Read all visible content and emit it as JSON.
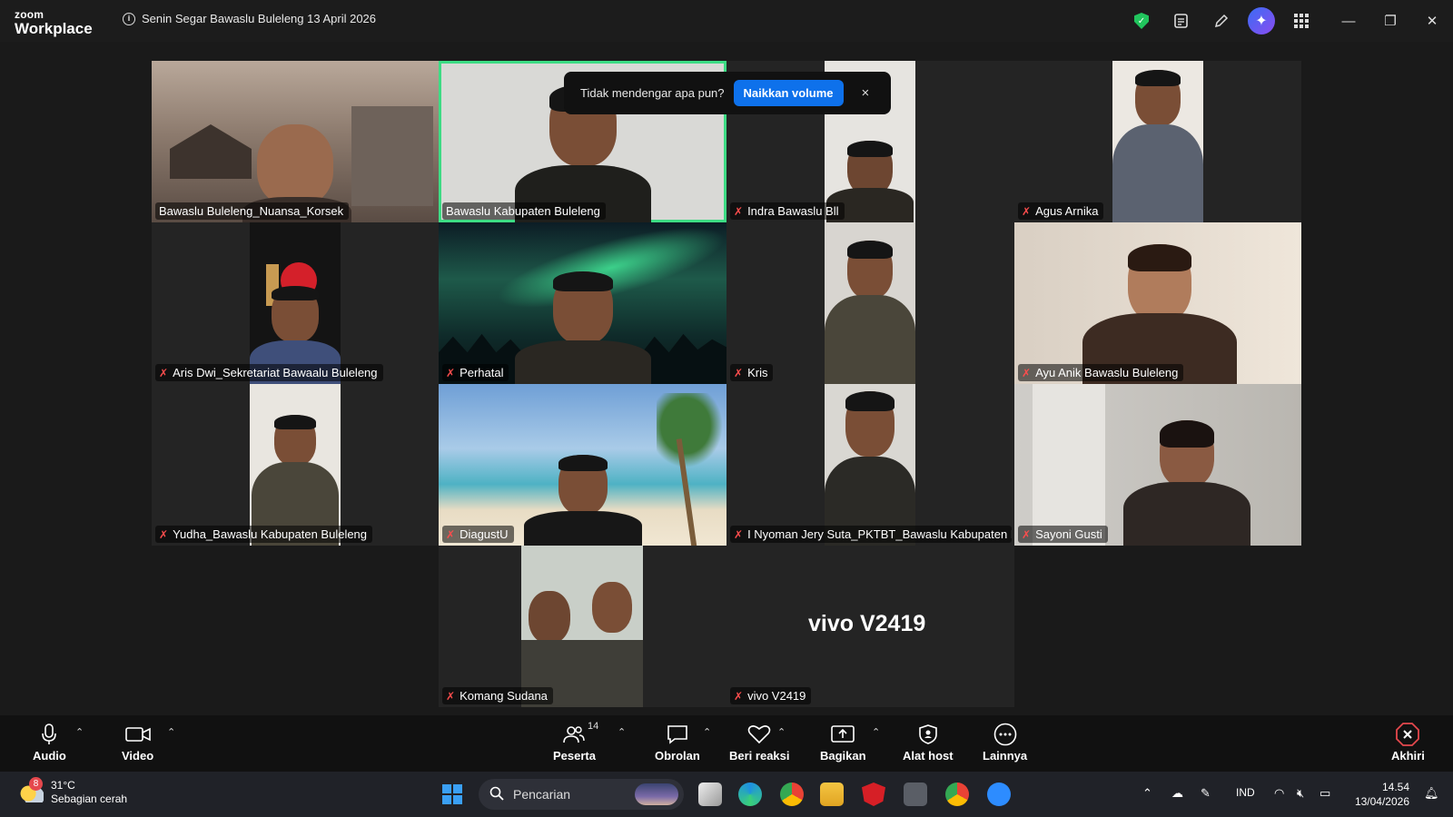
{
  "app": {
    "brand_small": "zoom",
    "brand_large": "Workplace",
    "meeting_title": "Senin Segar Bawaslu Buleleng 13 April 2026"
  },
  "popup": {
    "text": "Tidak mendengar apa pun?",
    "button": "Naikkan volume",
    "close": "×"
  },
  "participants": [
    {
      "name": "Bawaslu Buleleng_Nuansa_Korsek",
      "muted": false
    },
    {
      "name": "Bawaslu Kabupaten Buleleng",
      "muted": false,
      "active_speaker": true
    },
    {
      "name": "Indra Bawaslu Bll",
      "muted": true
    },
    {
      "name": "Agus Arnika",
      "muted": true
    },
    {
      "name": "Aris Dwi_Sekretariat Bawaalu Buleleng",
      "muted": true
    },
    {
      "name": "Perhatal",
      "muted": true
    },
    {
      "name": "Kris",
      "muted": true
    },
    {
      "name": "Ayu Anik Bawaslu Buleleng",
      "muted": true
    },
    {
      "name": "Yudha_Bawaslu Kabupaten Buleleng",
      "muted": true
    },
    {
      "name": "DiagustU",
      "muted": true
    },
    {
      "name": "I Nyoman Jery Suta_PKTBT_Bawaslu Kabupaten B...",
      "muted": true
    },
    {
      "name": "Sayoni Gusti",
      "muted": true
    },
    {
      "name": "Komang Sudana",
      "muted": true
    },
    {
      "name": "vivo V2419",
      "muted": true,
      "video_off_label": "vivo V2419"
    }
  ],
  "toolbar": {
    "audio": "Audio",
    "video": "Video",
    "participants": "Peserta",
    "participants_count": "14",
    "chat": "Obrolan",
    "react": "Beri reaksi",
    "share": "Bagikan",
    "host_tools": "Alat host",
    "more": "Lainnya",
    "end": "Akhiri"
  },
  "taskbar": {
    "weather_temp": "31°C",
    "weather_desc": "Sebagian cerah",
    "weather_badge": "8",
    "search_placeholder": "Pencarian",
    "language": "IND",
    "time": "14.54",
    "date": "13/04/2026"
  },
  "colors": {
    "active_border": "#3ddc84",
    "muted_mic": "#ff4d4d",
    "accent": "#0e71eb",
    "end_red": "#e5484d"
  }
}
